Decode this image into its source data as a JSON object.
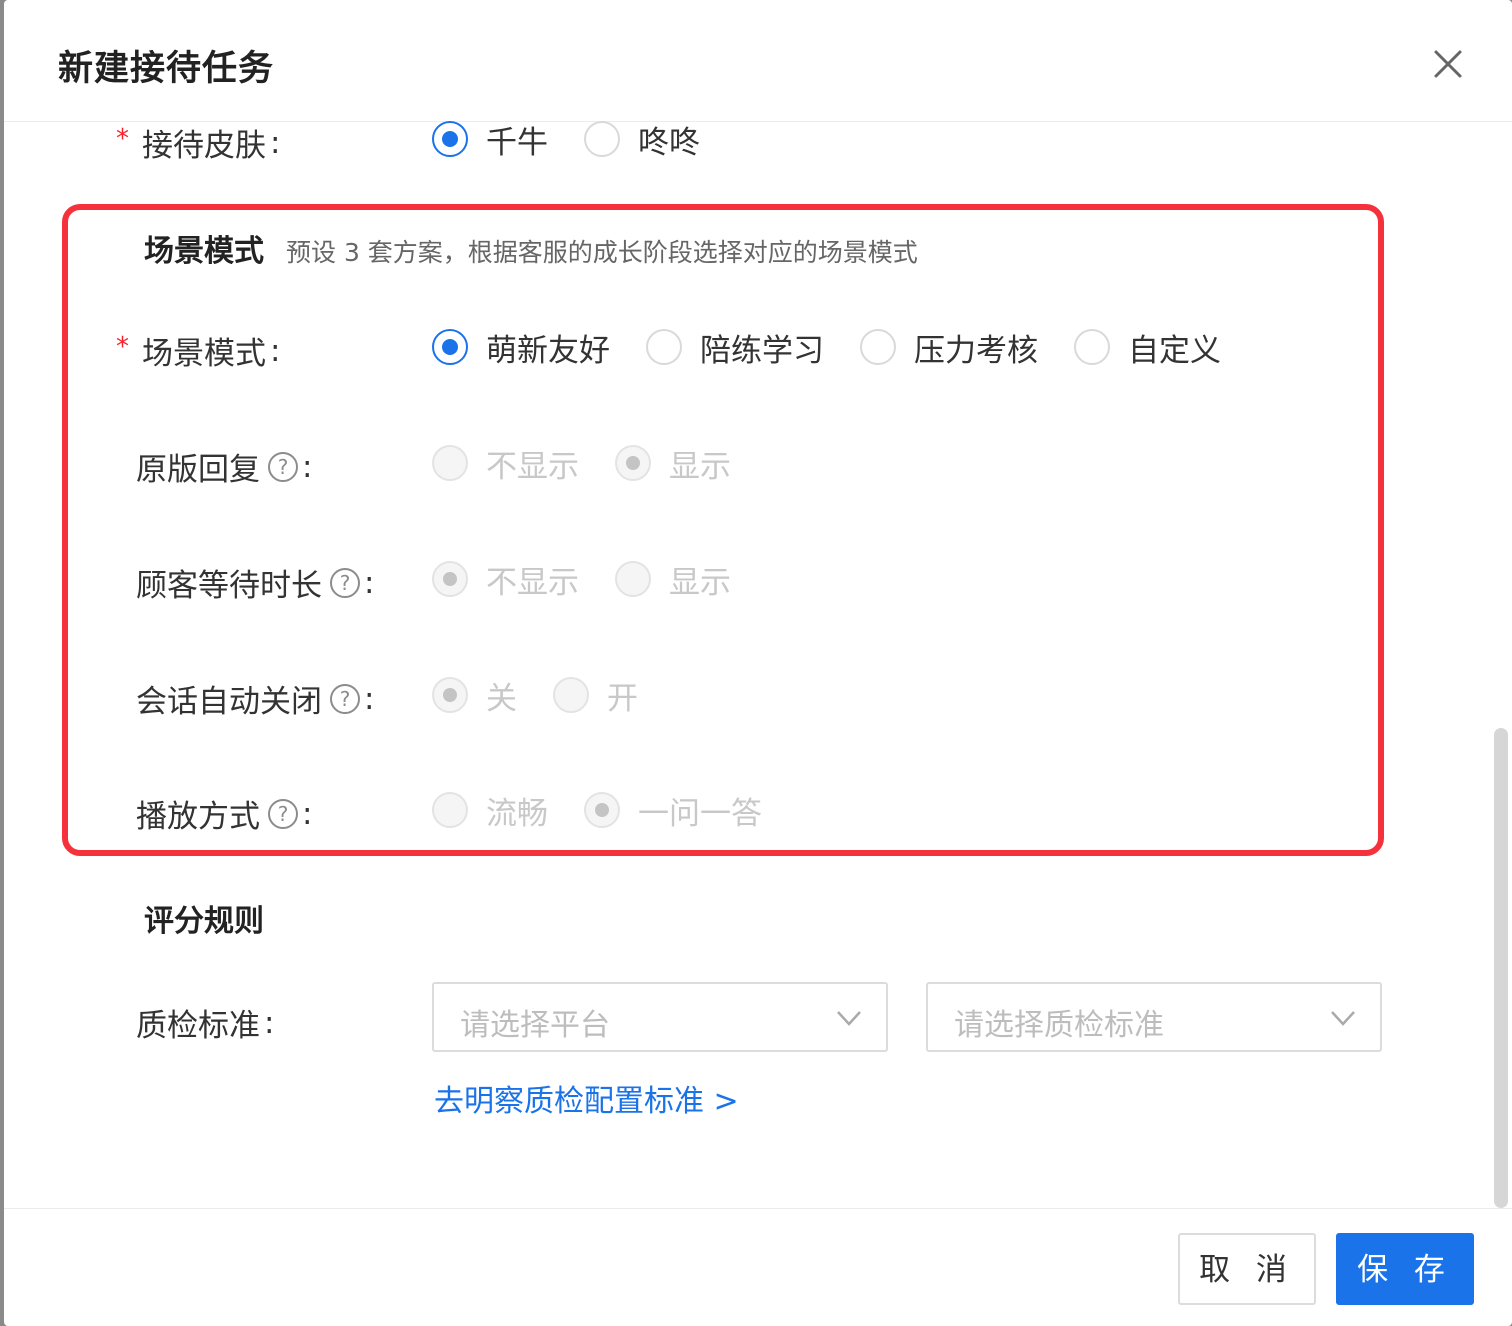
{
  "modal": {
    "title": "新建接待任务"
  },
  "skin": {
    "label": "接待皮肤",
    "required": "*",
    "options": [
      {
        "label": "千牛",
        "checked": true
      },
      {
        "label": "咚咚",
        "checked": false
      }
    ]
  },
  "scene_section": {
    "title": "场景模式",
    "description": "预设 3 套方案，根据客服的成长阶段选择对应的场景模式"
  },
  "scene_mode": {
    "label": "场景模式",
    "required": "*",
    "options": [
      {
        "label": "萌新友好",
        "checked": true
      },
      {
        "label": "陪练学习",
        "checked": false
      },
      {
        "label": "压力考核",
        "checked": false
      },
      {
        "label": "自定义",
        "checked": false
      }
    ]
  },
  "original_reply": {
    "label": "原版回复",
    "help": "?",
    "options": [
      {
        "label": "不显示",
        "checked": false
      },
      {
        "label": "显示",
        "checked": true
      }
    ]
  },
  "wait_time": {
    "label": "顾客等待时长",
    "help": "?",
    "options": [
      {
        "label": "不显示",
        "checked": true
      },
      {
        "label": "显示",
        "checked": false
      }
    ]
  },
  "auto_close": {
    "label": "会话自动关闭",
    "help": "?",
    "options": [
      {
        "label": "关",
        "checked": true
      },
      {
        "label": "开",
        "checked": false
      }
    ]
  },
  "playback": {
    "label": "播放方式",
    "help": "?",
    "options": [
      {
        "label": "流畅",
        "checked": false
      },
      {
        "label": "一问一答",
        "checked": true
      }
    ]
  },
  "scoring_section": {
    "title": "评分规则"
  },
  "qc_standard": {
    "label": "质检标准",
    "platform_placeholder": "请选择平台",
    "standard_placeholder": "请选择质检标准",
    "config_link": "去明察质检配置标准 >"
  },
  "footer": {
    "cancel": "取 消",
    "save": "保 存"
  },
  "colors": {
    "primary": "#1a73e8",
    "highlight": "#f5323c",
    "required": "#f5222d"
  },
  "icons": [
    "close-icon",
    "help-icon",
    "chevron-down-icon"
  ]
}
